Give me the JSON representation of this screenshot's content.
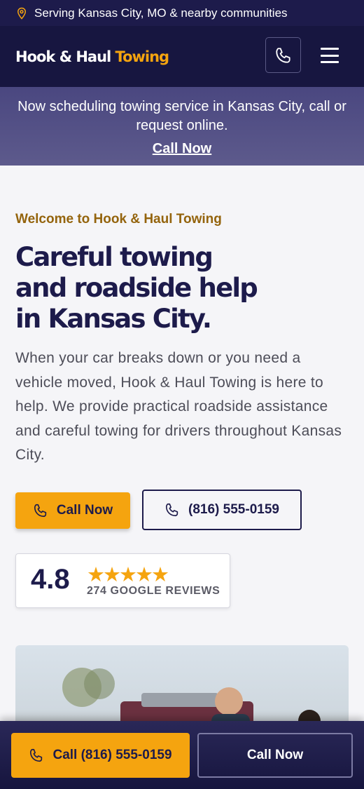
{
  "topbar": {
    "location_text": "Serving Kansas City, MO & nearby communities",
    "icon": "map-pin-icon"
  },
  "header": {
    "logo_main": "Hook & Haul",
    "logo_accent": "Towing",
    "phone_icon": "phone-icon",
    "menu_icon": "hamburger-menu-icon"
  },
  "announcement": {
    "text": "Now scheduling towing service in Kansas City, call or request online.",
    "link": "Call Now"
  },
  "hero": {
    "eyebrow": "Welcome to Hook & Haul Towing",
    "heading": "Careful towing and roadside help in Kansas City.",
    "body": "When your car breaks down or you need a vehicle moved, Hook & Haul Towing is here to help. We provide practical roadside assistance and careful towing for drivers throughout Kansas City.",
    "cta_primary": "Call Now",
    "cta_secondary": "(816) 555-0159"
  },
  "rating": {
    "score": "4.8",
    "stars": "★★★★★",
    "stars_value": 5,
    "count_label": "274 GOOGLE REVIEWS"
  },
  "bottom_bar": {
    "call_label": "Call (816) 555-0159",
    "cta_label": "Call Now"
  },
  "colors": {
    "navy": "#1d1b4b",
    "accent": "#f5a40f",
    "eyebrow": "#94640d"
  }
}
